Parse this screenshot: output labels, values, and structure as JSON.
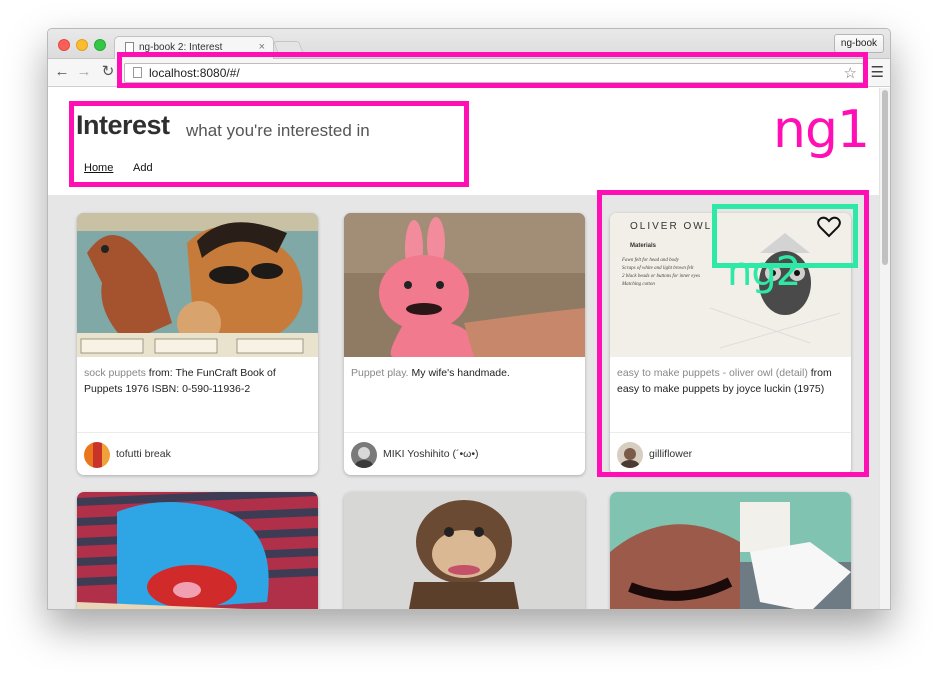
{
  "browser": {
    "tab_title": "ng-book 2: Interest",
    "tab_close": "×",
    "profile_button": "ng-book",
    "url": "localhost:8080/#/",
    "icons": [
      "back-arrow-icon",
      "forward-arrow-icon",
      "reload-icon",
      "page-icon",
      "star-icon",
      "menu-icon"
    ]
  },
  "header": {
    "title": "Interest",
    "tagline": "what you're interested in",
    "nav": {
      "home": "Home",
      "add": "Add"
    }
  },
  "annotations": {
    "ng1_label": "ng1",
    "ng2_label": "ng2",
    "highlight_color": "#ff0fb4",
    "accent_color": "#2ee8a8"
  },
  "cards": [
    {
      "lead": "sock puppets",
      "connector": " from: ",
      "rest": "The FunCraft Book of Puppets 1976 ISBN: 0-590-11936-2",
      "user": "tofutti break"
    },
    {
      "lead": "Puppet play.",
      "connector": " ",
      "rest": "My wife's handmade.",
      "user": "MIKI Yoshihito (´•ω•)"
    },
    {
      "lead": "easy to make puppets - oliver owl (detail)",
      "connector": " from ",
      "rest": "easy to make puppets by joyce luckin (1975)",
      "user": "gilliflower"
    }
  ],
  "owl_page": {
    "heading": "OLIVER OWL",
    "subheading": "Materials",
    "lines": [
      "Fawn felt for head and body",
      "Scraps of white and light brown felt",
      "2 black beads or buttons for inner eyes",
      "Matching cotton"
    ]
  }
}
